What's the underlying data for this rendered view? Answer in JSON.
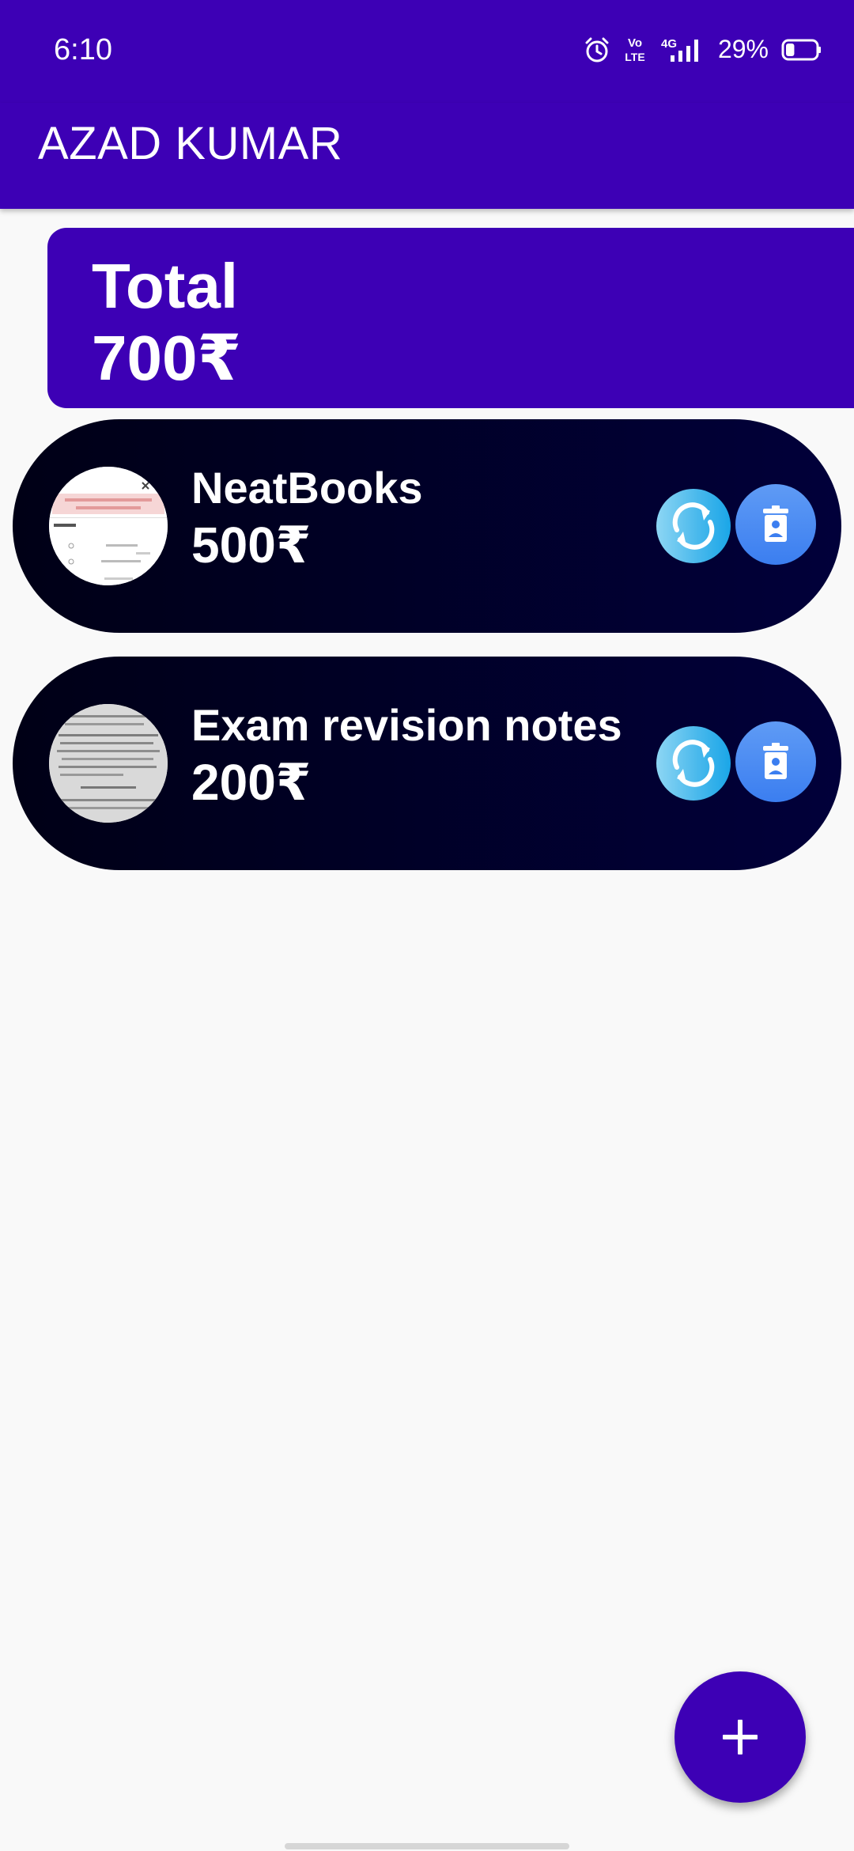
{
  "status_bar": {
    "time": "6:10",
    "volte_top": "Vo",
    "volte_bottom": "LTE",
    "network": "4G",
    "battery_percent": "29%",
    "battery_level": 0.29
  },
  "app_bar": {
    "title": "AZAD KUMAR"
  },
  "total": {
    "label": "Total",
    "value": "700₹"
  },
  "items": [
    {
      "name": "NeatBooks",
      "price": "500₹"
    },
    {
      "name": "Exam revision notes",
      "price": "200₹"
    }
  ],
  "fab": {
    "icon": "plus-icon"
  },
  "icons": {
    "refresh": "refresh-icon",
    "delete": "delete-icon"
  },
  "colors": {
    "primary": "#3d00b5",
    "card_dark": "#01003a",
    "refresh_button": "#4ab9ec",
    "delete_button": "#3b7ef0",
    "background": "#f9f9f9"
  }
}
